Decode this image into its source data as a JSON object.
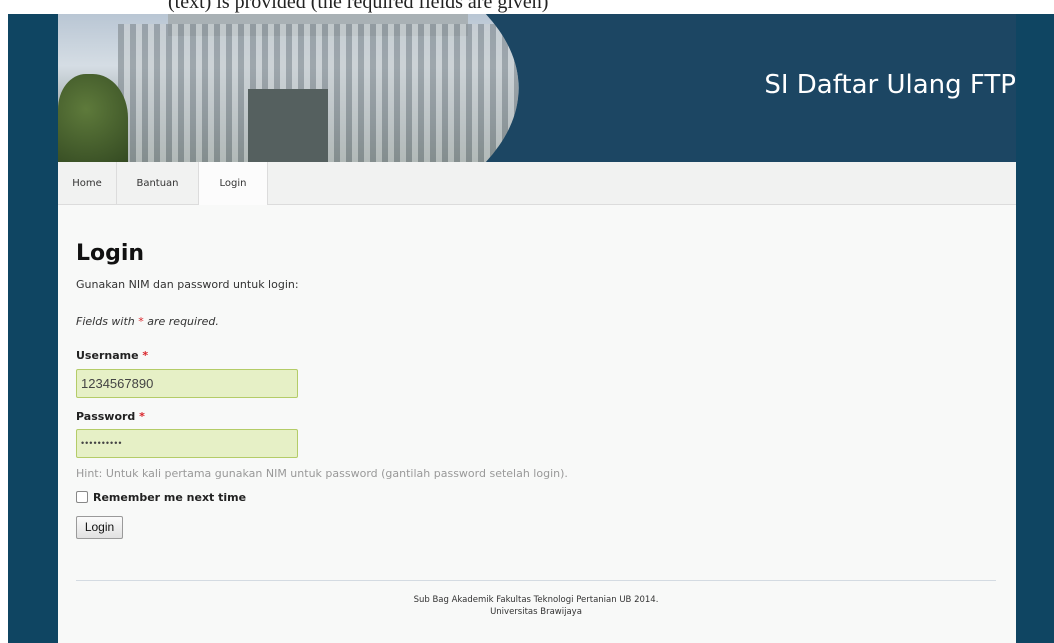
{
  "caption_fragment": "(text) is provided (the required fields are given)",
  "header": {
    "site_title": "SI Daftar Ulang FTP",
    "photo": "campus-building-photo"
  },
  "nav": {
    "items": [
      {
        "label": "Home"
      },
      {
        "label": "Bantuan"
      },
      {
        "label": "Login",
        "active": true
      }
    ]
  },
  "login_form": {
    "heading": "Login",
    "intro": "Gunakan NIM dan password untuk login:",
    "note_prefix": "Fields with ",
    "required_marker": "*",
    "note_suffix": " are required.",
    "username_label": "Username",
    "username_value": "1234567890",
    "password_label": "Password",
    "password_value": "••••••••••",
    "hint": "Hint: Untuk kali pertama gunakan NIM untuk password (gantilah password setelah login).",
    "remember_label": "Remember me next time",
    "remember_checked": false,
    "submit_label": "Login"
  },
  "footer": {
    "line1": "Sub Bag Akademik Fakultas Teknologi Pertanian UB 2014.",
    "line2": "Universitas Brawijaya"
  },
  "colors": {
    "outer_background": "#0f4562",
    "banner": "#1c4663",
    "input_background": "#e6f0c6",
    "required": "#d9242a"
  }
}
